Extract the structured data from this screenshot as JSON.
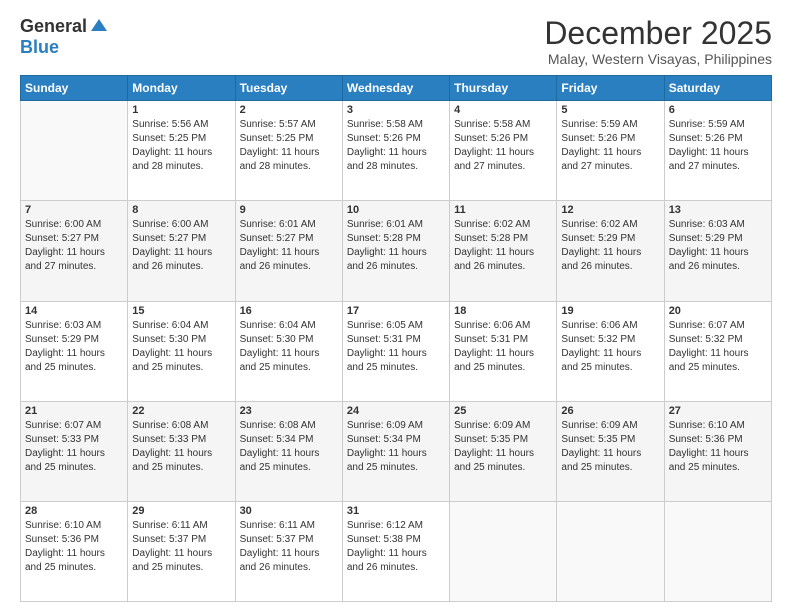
{
  "logo": {
    "general": "General",
    "blue": "Blue"
  },
  "title": "December 2025",
  "location": "Malay, Western Visayas, Philippines",
  "days_of_week": [
    "Sunday",
    "Monday",
    "Tuesday",
    "Wednesday",
    "Thursday",
    "Friday",
    "Saturday"
  ],
  "weeks": [
    [
      {
        "day": "",
        "info": ""
      },
      {
        "day": "1",
        "info": "Sunrise: 5:56 AM\nSunset: 5:25 PM\nDaylight: 11 hours\nand 28 minutes."
      },
      {
        "day": "2",
        "info": "Sunrise: 5:57 AM\nSunset: 5:25 PM\nDaylight: 11 hours\nand 28 minutes."
      },
      {
        "day": "3",
        "info": "Sunrise: 5:58 AM\nSunset: 5:26 PM\nDaylight: 11 hours\nand 28 minutes."
      },
      {
        "day": "4",
        "info": "Sunrise: 5:58 AM\nSunset: 5:26 PM\nDaylight: 11 hours\nand 27 minutes."
      },
      {
        "day": "5",
        "info": "Sunrise: 5:59 AM\nSunset: 5:26 PM\nDaylight: 11 hours\nand 27 minutes."
      },
      {
        "day": "6",
        "info": "Sunrise: 5:59 AM\nSunset: 5:26 PM\nDaylight: 11 hours\nand 27 minutes."
      }
    ],
    [
      {
        "day": "7",
        "info": "Sunrise: 6:00 AM\nSunset: 5:27 PM\nDaylight: 11 hours\nand 27 minutes."
      },
      {
        "day": "8",
        "info": "Sunrise: 6:00 AM\nSunset: 5:27 PM\nDaylight: 11 hours\nand 26 minutes."
      },
      {
        "day": "9",
        "info": "Sunrise: 6:01 AM\nSunset: 5:27 PM\nDaylight: 11 hours\nand 26 minutes."
      },
      {
        "day": "10",
        "info": "Sunrise: 6:01 AM\nSunset: 5:28 PM\nDaylight: 11 hours\nand 26 minutes."
      },
      {
        "day": "11",
        "info": "Sunrise: 6:02 AM\nSunset: 5:28 PM\nDaylight: 11 hours\nand 26 minutes."
      },
      {
        "day": "12",
        "info": "Sunrise: 6:02 AM\nSunset: 5:29 PM\nDaylight: 11 hours\nand 26 minutes."
      },
      {
        "day": "13",
        "info": "Sunrise: 6:03 AM\nSunset: 5:29 PM\nDaylight: 11 hours\nand 26 minutes."
      }
    ],
    [
      {
        "day": "14",
        "info": "Sunrise: 6:03 AM\nSunset: 5:29 PM\nDaylight: 11 hours\nand 25 minutes."
      },
      {
        "day": "15",
        "info": "Sunrise: 6:04 AM\nSunset: 5:30 PM\nDaylight: 11 hours\nand 25 minutes."
      },
      {
        "day": "16",
        "info": "Sunrise: 6:04 AM\nSunset: 5:30 PM\nDaylight: 11 hours\nand 25 minutes."
      },
      {
        "day": "17",
        "info": "Sunrise: 6:05 AM\nSunset: 5:31 PM\nDaylight: 11 hours\nand 25 minutes."
      },
      {
        "day": "18",
        "info": "Sunrise: 6:06 AM\nSunset: 5:31 PM\nDaylight: 11 hours\nand 25 minutes."
      },
      {
        "day": "19",
        "info": "Sunrise: 6:06 AM\nSunset: 5:32 PM\nDaylight: 11 hours\nand 25 minutes."
      },
      {
        "day": "20",
        "info": "Sunrise: 6:07 AM\nSunset: 5:32 PM\nDaylight: 11 hours\nand 25 minutes."
      }
    ],
    [
      {
        "day": "21",
        "info": "Sunrise: 6:07 AM\nSunset: 5:33 PM\nDaylight: 11 hours\nand 25 minutes."
      },
      {
        "day": "22",
        "info": "Sunrise: 6:08 AM\nSunset: 5:33 PM\nDaylight: 11 hours\nand 25 minutes."
      },
      {
        "day": "23",
        "info": "Sunrise: 6:08 AM\nSunset: 5:34 PM\nDaylight: 11 hours\nand 25 minutes."
      },
      {
        "day": "24",
        "info": "Sunrise: 6:09 AM\nSunset: 5:34 PM\nDaylight: 11 hours\nand 25 minutes."
      },
      {
        "day": "25",
        "info": "Sunrise: 6:09 AM\nSunset: 5:35 PM\nDaylight: 11 hours\nand 25 minutes."
      },
      {
        "day": "26",
        "info": "Sunrise: 6:09 AM\nSunset: 5:35 PM\nDaylight: 11 hours\nand 25 minutes."
      },
      {
        "day": "27",
        "info": "Sunrise: 6:10 AM\nSunset: 5:36 PM\nDaylight: 11 hours\nand 25 minutes."
      }
    ],
    [
      {
        "day": "28",
        "info": "Sunrise: 6:10 AM\nSunset: 5:36 PM\nDaylight: 11 hours\nand 25 minutes."
      },
      {
        "day": "29",
        "info": "Sunrise: 6:11 AM\nSunset: 5:37 PM\nDaylight: 11 hours\nand 25 minutes."
      },
      {
        "day": "30",
        "info": "Sunrise: 6:11 AM\nSunset: 5:37 PM\nDaylight: 11 hours\nand 26 minutes."
      },
      {
        "day": "31",
        "info": "Sunrise: 6:12 AM\nSunset: 5:38 PM\nDaylight: 11 hours\nand 26 minutes."
      },
      {
        "day": "",
        "info": ""
      },
      {
        "day": "",
        "info": ""
      },
      {
        "day": "",
        "info": ""
      }
    ]
  ]
}
